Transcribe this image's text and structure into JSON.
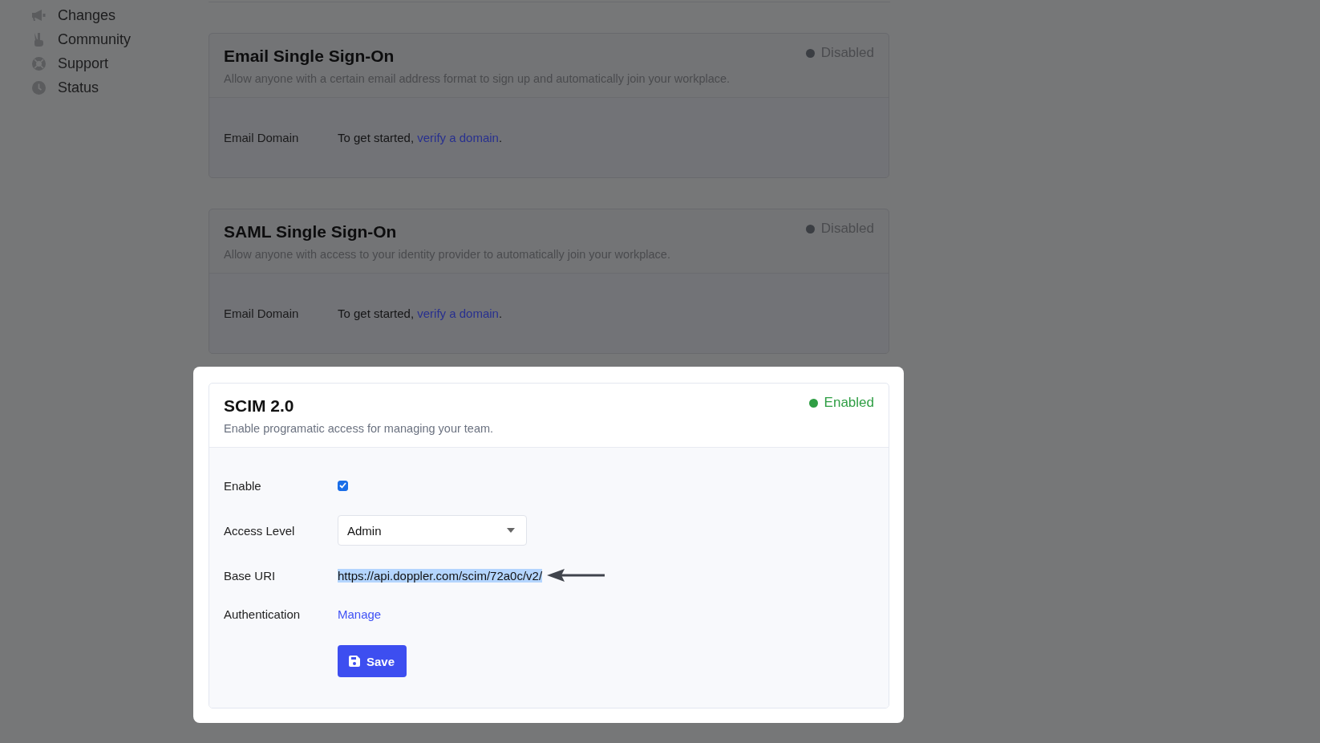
{
  "sidebar": {
    "items": [
      {
        "label": "Changes"
      },
      {
        "label": "Community"
      },
      {
        "label": "Support"
      },
      {
        "label": "Status"
      }
    ]
  },
  "cards": [
    {
      "title": "Email Single Sign-On",
      "description": "Allow anyone with a certain email address format to sign up and automatically join your workplace.",
      "highlighted": false,
      "status": {
        "label": "Disabled",
        "enabled": false
      },
      "rows": [
        {
          "kind": "text",
          "label": "Email Domain",
          "before": "To get started, ",
          "link": "verify a domain",
          "after": "."
        }
      ]
    },
    {
      "title": "SAML Single Sign-On",
      "description": "Allow anyone with access to your identity provider to automatically join your workplace.",
      "highlighted": false,
      "status": {
        "label": "Disabled",
        "enabled": false
      },
      "rows": [
        {
          "kind": "text",
          "label": "Email Domain",
          "before": "To get started, ",
          "link": "verify a domain",
          "after": "."
        }
      ]
    },
    {
      "title": "SCIM 2.0",
      "description": "Enable programatic access for managing your team.",
      "highlighted": true,
      "status": {
        "label": "Enabled",
        "enabled": true
      },
      "rows": [
        {
          "kind": "checkbox",
          "label": "Enable",
          "checked": true
        },
        {
          "kind": "select",
          "label": "Access Level",
          "value": "Admin"
        },
        {
          "kind": "url",
          "label": "Base URI",
          "value": "https://api.doppler.com/scim/72a0c/v2/",
          "selected": true
        },
        {
          "kind": "link",
          "label": "Authentication",
          "value": "Manage"
        },
        {
          "kind": "button",
          "label": "Save"
        }
      ]
    }
  ]
}
